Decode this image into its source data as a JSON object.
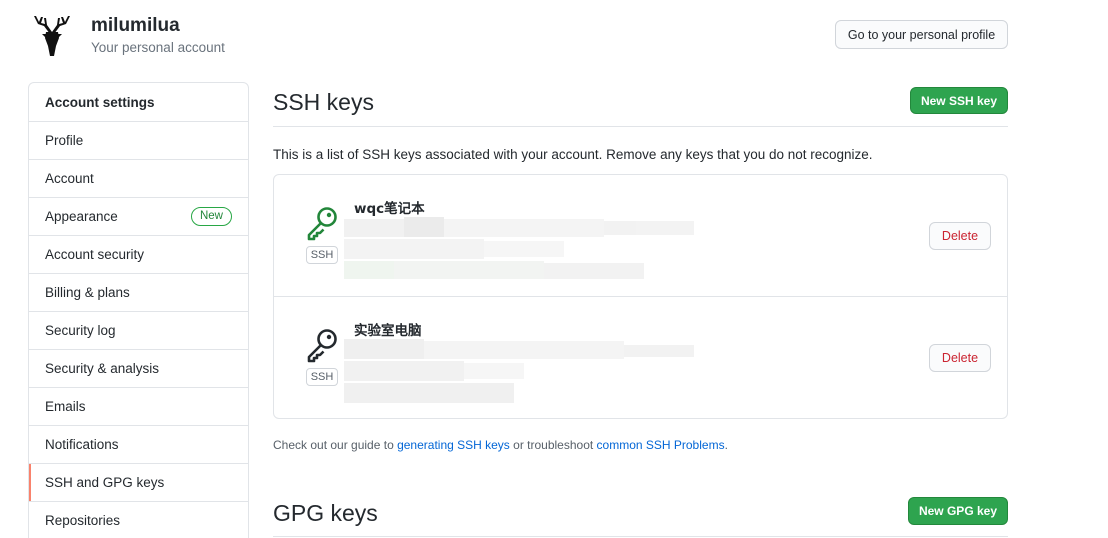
{
  "header": {
    "username": "milumilua",
    "subtitle": "Your personal account",
    "profile_button": "Go to your personal profile"
  },
  "sidebar": {
    "heading": "Account settings",
    "items": [
      {
        "label": "Profile"
      },
      {
        "label": "Account"
      },
      {
        "label": "Appearance",
        "badge": "New"
      },
      {
        "label": "Account security"
      },
      {
        "label": "Billing & plans"
      },
      {
        "label": "Security log"
      },
      {
        "label": "Security & analysis"
      },
      {
        "label": "Emails"
      },
      {
        "label": "Notifications"
      },
      {
        "label": "SSH and GPG keys",
        "active": true
      },
      {
        "label": "Repositories"
      }
    ]
  },
  "ssh": {
    "title": "SSH keys",
    "new_button": "New SSH key",
    "description": "This is a list of SSH keys associated with your account. Remove any keys that you do not recognize.",
    "keys": [
      {
        "title": "wqc笔记本",
        "type_label": "SSH",
        "delete_label": "Delete",
        "icon_color": "#22863a"
      },
      {
        "title": "实验室电脑",
        "type_label": "SSH",
        "delete_label": "Delete",
        "icon_color": "#24292e"
      }
    ],
    "guide_prefix": "Check out our guide to ",
    "guide_link1": "generating SSH keys",
    "guide_mid": " or troubleshoot ",
    "guide_link2": "common SSH Problems",
    "guide_suffix": "."
  },
  "gpg": {
    "title": "GPG keys",
    "new_button": "New GPG key"
  },
  "colors": {
    "accent_green": "#2ea44f",
    "active_marker": "#f9826c",
    "danger": "#cb2431",
    "link": "#0366d6"
  }
}
